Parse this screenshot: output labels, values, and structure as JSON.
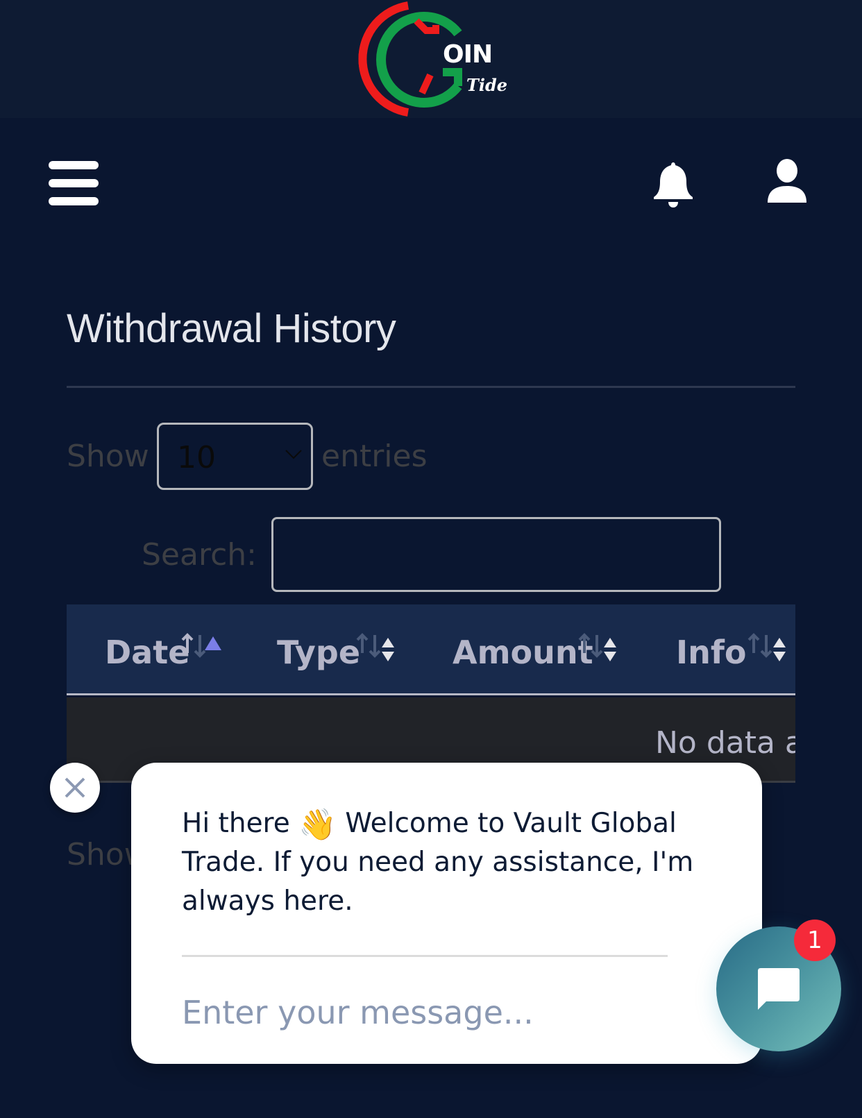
{
  "brand": {
    "name_main": "OIN",
    "name_sub": "Tide",
    "colors": {
      "red": "#ee1c1c",
      "green": "#13a04a"
    }
  },
  "navbar": {
    "menu_icon": "hamburger-icon",
    "notifications_icon": "bell-icon",
    "profile_icon": "user-icon"
  },
  "page": {
    "title": "Withdrawal History"
  },
  "table_controls": {
    "show_label": "Show",
    "page_length": "10",
    "entries_label": "entries",
    "search_label": "Search:",
    "search_value": ""
  },
  "table": {
    "columns": [
      {
        "label": "Date",
        "sort": "ascending"
      },
      {
        "label": "Type",
        "sort": "none"
      },
      {
        "label": "Amount",
        "sort": "none"
      },
      {
        "label": "Info",
        "sort": "none"
      }
    ],
    "empty_message": "No data a",
    "sort_active_color": "#7b7ee8"
  },
  "footer_info": {
    "text": "Show"
  },
  "chat": {
    "greeting_before_emoji": "Hi there",
    "emoji": "👋",
    "greeting_after_emoji": " Welcome to Vault Global Trade. If you need any assistance, I'm always here.",
    "input_placeholder": "Enter your message...",
    "unread_count": "1",
    "close_icon": "close-icon",
    "launcher_icon": "chat-bubble-icon"
  }
}
